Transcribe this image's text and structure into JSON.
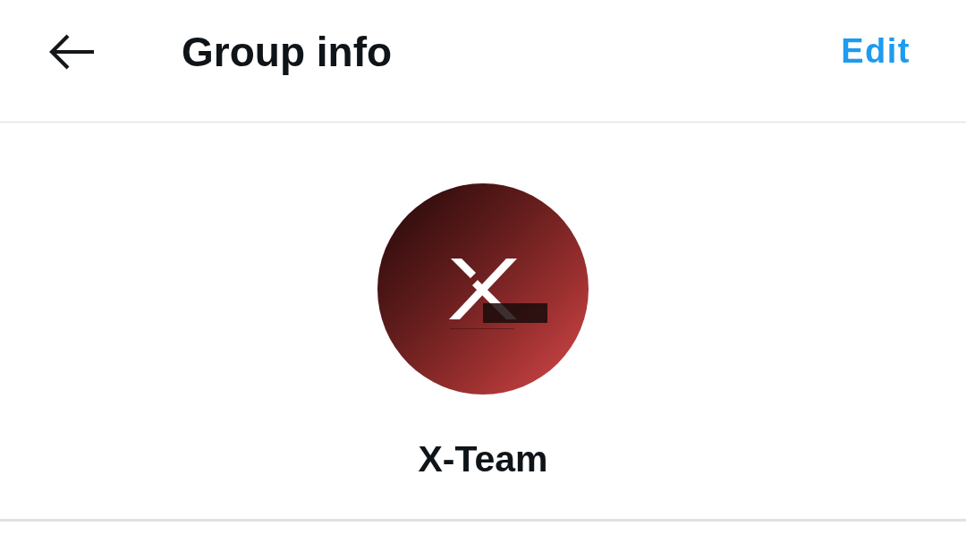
{
  "header": {
    "title": "Group info",
    "action": "Edit"
  },
  "group": {
    "name": "X-Team"
  }
}
